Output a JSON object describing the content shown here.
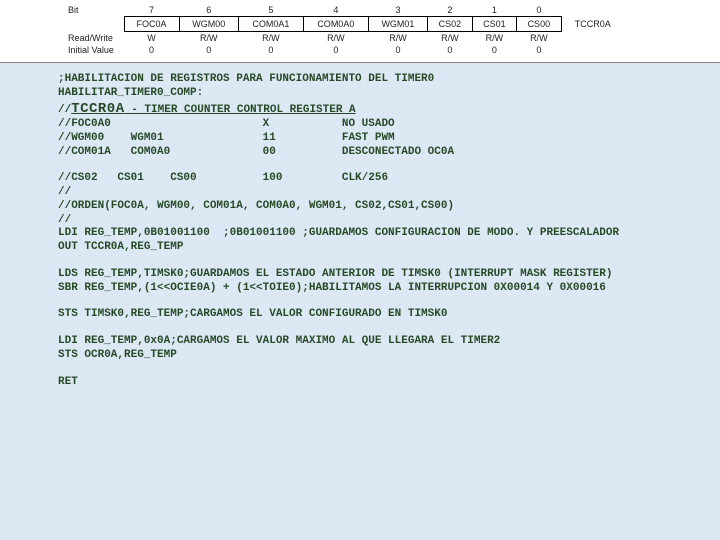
{
  "table": {
    "rowlabels": {
      "bit": "Bit",
      "rw": "Read/Write",
      "iv": "Initial Value"
    },
    "bits": [
      "7",
      "6",
      "5",
      "4",
      "3",
      "2",
      "1",
      "0"
    ],
    "names": [
      "FOC0A",
      "WGM00",
      "COM0A1",
      "COM0A0",
      "WGM01",
      "CS02",
      "CS01",
      "CS00"
    ],
    "rw": [
      "W",
      "R/W",
      "R/W",
      "R/W",
      "R/W",
      "R/W",
      "R/W",
      "R/W"
    ],
    "initial": [
      "0",
      "0",
      "0",
      "0",
      "0",
      "0",
      "0",
      "0"
    ],
    "regname": "TCCR0A"
  },
  "lines": {
    "l01": ";HABILITACION DE REGISTROS PARA FUNCIONAMIENTO DEL TIMER0",
    "l02": "HABILITAR_TIMER0_COMP:",
    "l03a": "//",
    "l03b": "TCCR0A",
    "l03c": " - TIMER COUNTER CONTROL REGISTER A",
    "l04": "//FOC0A0                       X           NO USADO",
    "l05": "//WGM00    WGM01               11          FAST PWM",
    "l06": "//COM01A   COM0A0              00          DESCONECTADO OC0A",
    "l07": "//CS02   CS01    CS00          100         CLK/256",
    "l08": "//",
    "l09": "//ORDEN(FOC0A, WGM00, COM01A, COM0A0, WGM01, CS02,CS01,CS00)",
    "l10": "//",
    "l11": "LDI REG_TEMP,0B01001100  ;0B01001100 ;GUARDAMOS CONFIGURACION DE MODO. Y PREESCALADOR",
    "l12": "OUT TCCR0A,REG_TEMP",
    "l13": "LDS REG_TEMP,TIMSK0;GUARDAMOS EL ESTADO ANTERIOR DE TIMSK0 (INTERRUPT MASK REGISTER)",
    "l14": "SBR REG_TEMP,(1<<OCIE0A) + (1<<TOIE0);HABILITAMOS LA INTERRUPCION 0X00014 Y 0X00016",
    "l15": "STS TIMSK0,REG_TEMP;CARGAMOS EL VALOR CONFIGURADO EN TIMSK0",
    "l16": "LDI REG_TEMP,0x0A;CARGAMOS EL VALOR MAXIMO AL QUE LLEGARA EL TIMER2",
    "l17": "STS OCR0A,REG_TEMP",
    "l18": "RET"
  }
}
